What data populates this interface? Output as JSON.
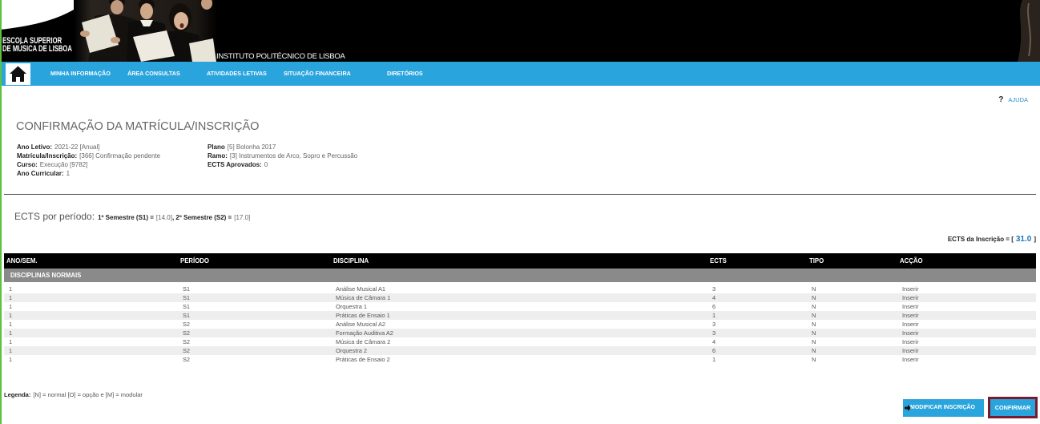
{
  "header": {
    "logo_line1": "ESCOLA SUPERIOR",
    "logo_line2": "DE MÚSICA DE LISBOA",
    "institute": "INSTITUTO POLITÉCNICO DE LISBOA"
  },
  "nav": {
    "home_icon": "home-icon",
    "items": [
      {
        "label": "MINHA INFORMAÇÃO"
      },
      {
        "label": "ÁREA CONSULTAS"
      },
      {
        "label": "ATIVIDADES LETIVAS"
      },
      {
        "label": "SITUAÇÃO FINANCEIRA"
      },
      {
        "label": "DIRETÓRIOS"
      }
    ]
  },
  "help": {
    "icon": "help-icon",
    "symbol": "?",
    "label": "AJUDA"
  },
  "page_title": "CONFIRMAÇÃO DA MATRÍCULA/INSCRIÇÃO",
  "info": {
    "ano_letivo": {
      "label": "Ano Letivo:",
      "value": "2021-22 [Anual]"
    },
    "matricula": {
      "label": "Matrícula/Inscrição:",
      "value": "[366] Confirmação pendente"
    },
    "curso": {
      "label": "Curso:",
      "value": "Execução [9782]"
    },
    "ano_curricular": {
      "label": "Ano Curricular:",
      "value": "1"
    },
    "plano": {
      "label": "Plano",
      "value": "[5] Bolonha 2017"
    },
    "ramo": {
      "label": "Ramo:",
      "value": "[3] Instrumentos de Arco, Sopro e Percussão"
    },
    "ects_aprovados": {
      "label": "ECTS Aprovados:",
      "value": "0"
    }
  },
  "ects_por_periodo": {
    "label": "ECTS por período:",
    "s1_label": "1º Semestre (S1) =",
    "s1_value": "[14.0]",
    "s2_label": ", 2º Semestre (S2) =",
    "s2_value": "[17.0]"
  },
  "ects_inscricao": {
    "label": "ECTS da Inscrição = [",
    "value": "31.0",
    "close": "]"
  },
  "table": {
    "columns": [
      "ANO/SEM.",
      "PERÍODO",
      "DISCIPLINA",
      "ECTS",
      "TIPO",
      "ACÇÃO"
    ],
    "group_label": "DISCIPLINAS NORMAIS",
    "rows": [
      {
        "ano": "1",
        "periodo": "S1",
        "disciplina": "Análise Musical A1",
        "ects": "3",
        "tipo": "N",
        "accao": "Inserir"
      },
      {
        "ano": "1",
        "periodo": "S1",
        "disciplina": "Música de Câmara 1",
        "ects": "4",
        "tipo": "N",
        "accao": "Inserir"
      },
      {
        "ano": "1",
        "periodo": "S1",
        "disciplina": "Orquestra 1",
        "ects": "6",
        "tipo": "N",
        "accao": "Inserir"
      },
      {
        "ano": "1",
        "periodo": "S1",
        "disciplina": "Práticas de Ensaio 1",
        "ects": "1",
        "tipo": "N",
        "accao": "Inserir"
      },
      {
        "ano": "1",
        "periodo": "S2",
        "disciplina": "Análise Musical A2",
        "ects": "3",
        "tipo": "N",
        "accao": "Inserir"
      },
      {
        "ano": "1",
        "periodo": "S2",
        "disciplina": "Formação Auditiva A2",
        "ects": "3",
        "tipo": "N",
        "accao": "Inserir"
      },
      {
        "ano": "1",
        "periodo": "S2",
        "disciplina": "Música de Câmara 2",
        "ects": "4",
        "tipo": "N",
        "accao": "Inserir"
      },
      {
        "ano": "1",
        "periodo": "S2",
        "disciplina": "Orquestra 2",
        "ects": "6",
        "tipo": "N",
        "accao": "Inserir"
      },
      {
        "ano": "1",
        "periodo": "S2",
        "disciplina": "Práticas de Ensaio 2",
        "ects": "1",
        "tipo": "N",
        "accao": "Inserir"
      }
    ]
  },
  "legend": {
    "label": "Legenda:",
    "text": "[N] = normal [O] = opção e [M] = modular"
  },
  "buttons": {
    "modify_icon": "arrow-right-icon",
    "modify": "MODIFICAR INSCRIÇÃO",
    "confirm": "CONFIRMAR"
  },
  "colors": {
    "nav_bg": "#2aa4dd",
    "button_bg": "#2aa4dd",
    "confirm_border": "#7b1a2c",
    "group_row_bg": "#8a8a8a",
    "row_alt_bg": "#eeeeee",
    "accent_text": "#1b75bc",
    "page_edge": "#5cc23c",
    "help_link": "#2a8fd0"
  }
}
